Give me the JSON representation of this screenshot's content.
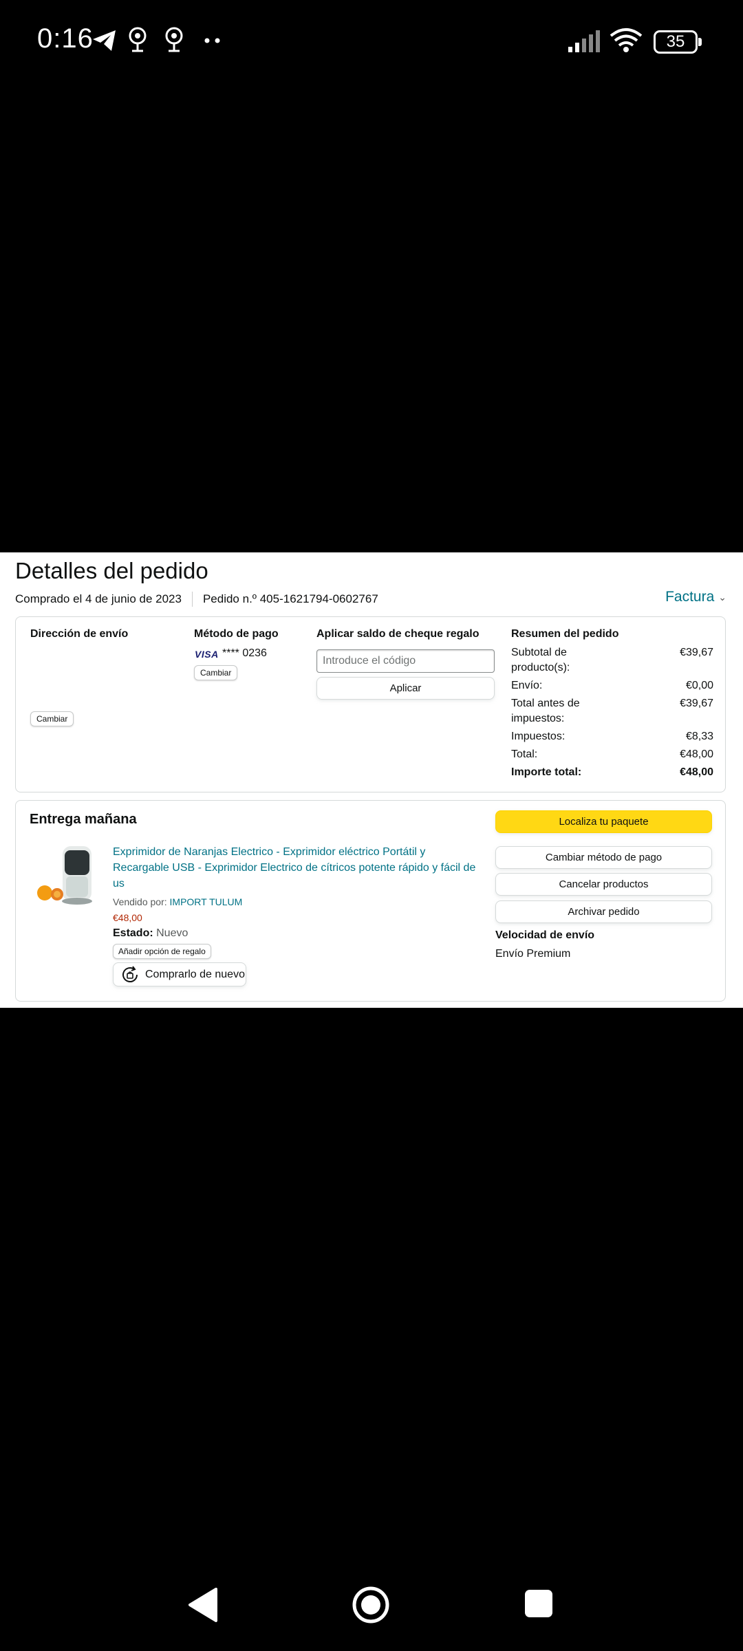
{
  "status_bar": {
    "time": "0:16",
    "battery": "35",
    "icons": [
      "telegram-icon",
      "location-icon",
      "location-icon",
      "more-icon",
      "signal-icon",
      "wifi-icon",
      "battery-icon"
    ]
  },
  "order": {
    "title": "Detalles del pedido",
    "purchase_date": "Comprado el 4 de junio de 2023",
    "order_number": "Pedido n.º 405-1621794-0602767",
    "invoice_label": "Factura"
  },
  "shipping": {
    "heading": "Dirección de envío",
    "change_label": "Cambiar"
  },
  "payment": {
    "heading": "Método de pago",
    "card_brand": "VISA",
    "card_last": "**** 0236",
    "change_label": "Cambiar"
  },
  "gift_card": {
    "heading": "Aplicar saldo de cheque regalo",
    "placeholder": "Introduce el código",
    "apply_label": "Aplicar"
  },
  "summary": {
    "heading": "Resumen del pedido",
    "rows": [
      {
        "label": "Subtotal de producto(s):",
        "value": "€39,67"
      },
      {
        "label": "Envío:",
        "value": "€0,00"
      },
      {
        "label": "Total antes de impuestos:",
        "value": "€39,67"
      },
      {
        "label": "Impuestos:",
        "value": "€8,33"
      },
      {
        "label": "Total:",
        "value": "€48,00"
      },
      {
        "label": "Importe total:",
        "value": "€48,00"
      }
    ]
  },
  "delivery": {
    "heading": "Entrega mañana",
    "product_title": "Exprimidor de Naranjas Electrico - Exprimidor eléctrico Portátil y Recargable USB - Exprimidor Electrico de cítricos potente rápido y fácil de us",
    "sold_by_label": "Vendido por:",
    "seller": "IMPORT TULUM",
    "price": "€48,00",
    "status_label": "Estado:",
    "status_value": "Nuevo",
    "gift_option": "Añadir opción de regalo",
    "buy_again": "Comprarlo de nuevo",
    "actions": {
      "track": "Localiza tu paquete",
      "change_payment": "Cambiar método de pago",
      "cancel": "Cancelar productos",
      "archive": "Archivar pedido"
    },
    "speed_heading": "Velocidad de envío",
    "speed_value": "Envío Premium"
  },
  "colors": {
    "link": "#007185",
    "price": "#b12704",
    "primary_button": "#ffd814"
  }
}
